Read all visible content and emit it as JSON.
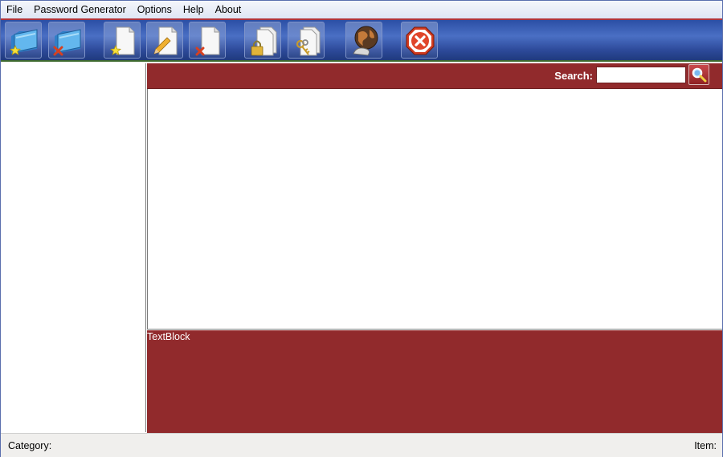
{
  "menu": {
    "items": [
      "File",
      "Password Generator",
      "Options",
      "Help",
      "About"
    ]
  },
  "toolbar": {
    "buttons": [
      {
        "name": "add-category-button",
        "icon": "folder-star-icon"
      },
      {
        "name": "delete-category-button",
        "icon": "folder-delete-icon"
      },
      {
        "name": "add-item-button",
        "icon": "page-star-icon"
      },
      {
        "name": "edit-item-button",
        "icon": "page-edit-icon"
      },
      {
        "name": "delete-item-button",
        "icon": "page-delete-icon"
      },
      {
        "name": "lock-button",
        "icon": "lock-icon"
      },
      {
        "name": "keys-button",
        "icon": "keys-icon"
      },
      {
        "name": "web-button",
        "icon": "globe-icon"
      },
      {
        "name": "exit-button",
        "icon": "close-icon"
      }
    ]
  },
  "search": {
    "label": "Search:",
    "value": "",
    "placeholder": ""
  },
  "detail": {
    "text": "TextBlock"
  },
  "status": {
    "category_label": "Category:",
    "item_label": "Item:"
  },
  "colors": {
    "accent_red": "#912a2c",
    "toolbar_blue": "#2b4fa5"
  }
}
